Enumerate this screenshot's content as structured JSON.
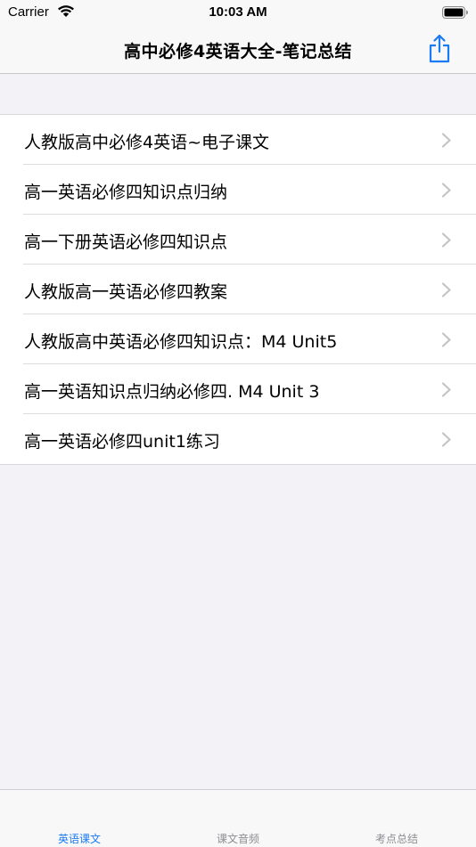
{
  "status_bar": {
    "carrier": "Carrier",
    "time": "10:03 AM"
  },
  "nav": {
    "title": "高中必修4英语大全-笔记总结",
    "share_icon": "share-icon"
  },
  "list": {
    "items": [
      {
        "label": "人教版高中必修4英语~电子课文"
      },
      {
        "label": "高一英语必修四知识点归纳"
      },
      {
        "label": "高一下册英语必修四知识点"
      },
      {
        "label": "人教版高一英语必修四教案"
      },
      {
        "label": "人教版高中英语必修四知识点：M4 Unit5"
      },
      {
        "label": "高一英语知识点归纳必修四. M4 Unit 3"
      },
      {
        "label": "高一英语必修四unit1练习"
      }
    ]
  },
  "tab_bar": {
    "tabs": [
      {
        "label": "英语课文",
        "selected": true
      },
      {
        "label": "课文音频",
        "selected": false
      },
      {
        "label": "考点总结",
        "selected": false
      }
    ]
  },
  "colors": {
    "accent": "#1a7bf2",
    "chevron": "#c4c4c7",
    "tab_inactive": "#8e8e93",
    "background": "#f2f2f7"
  }
}
